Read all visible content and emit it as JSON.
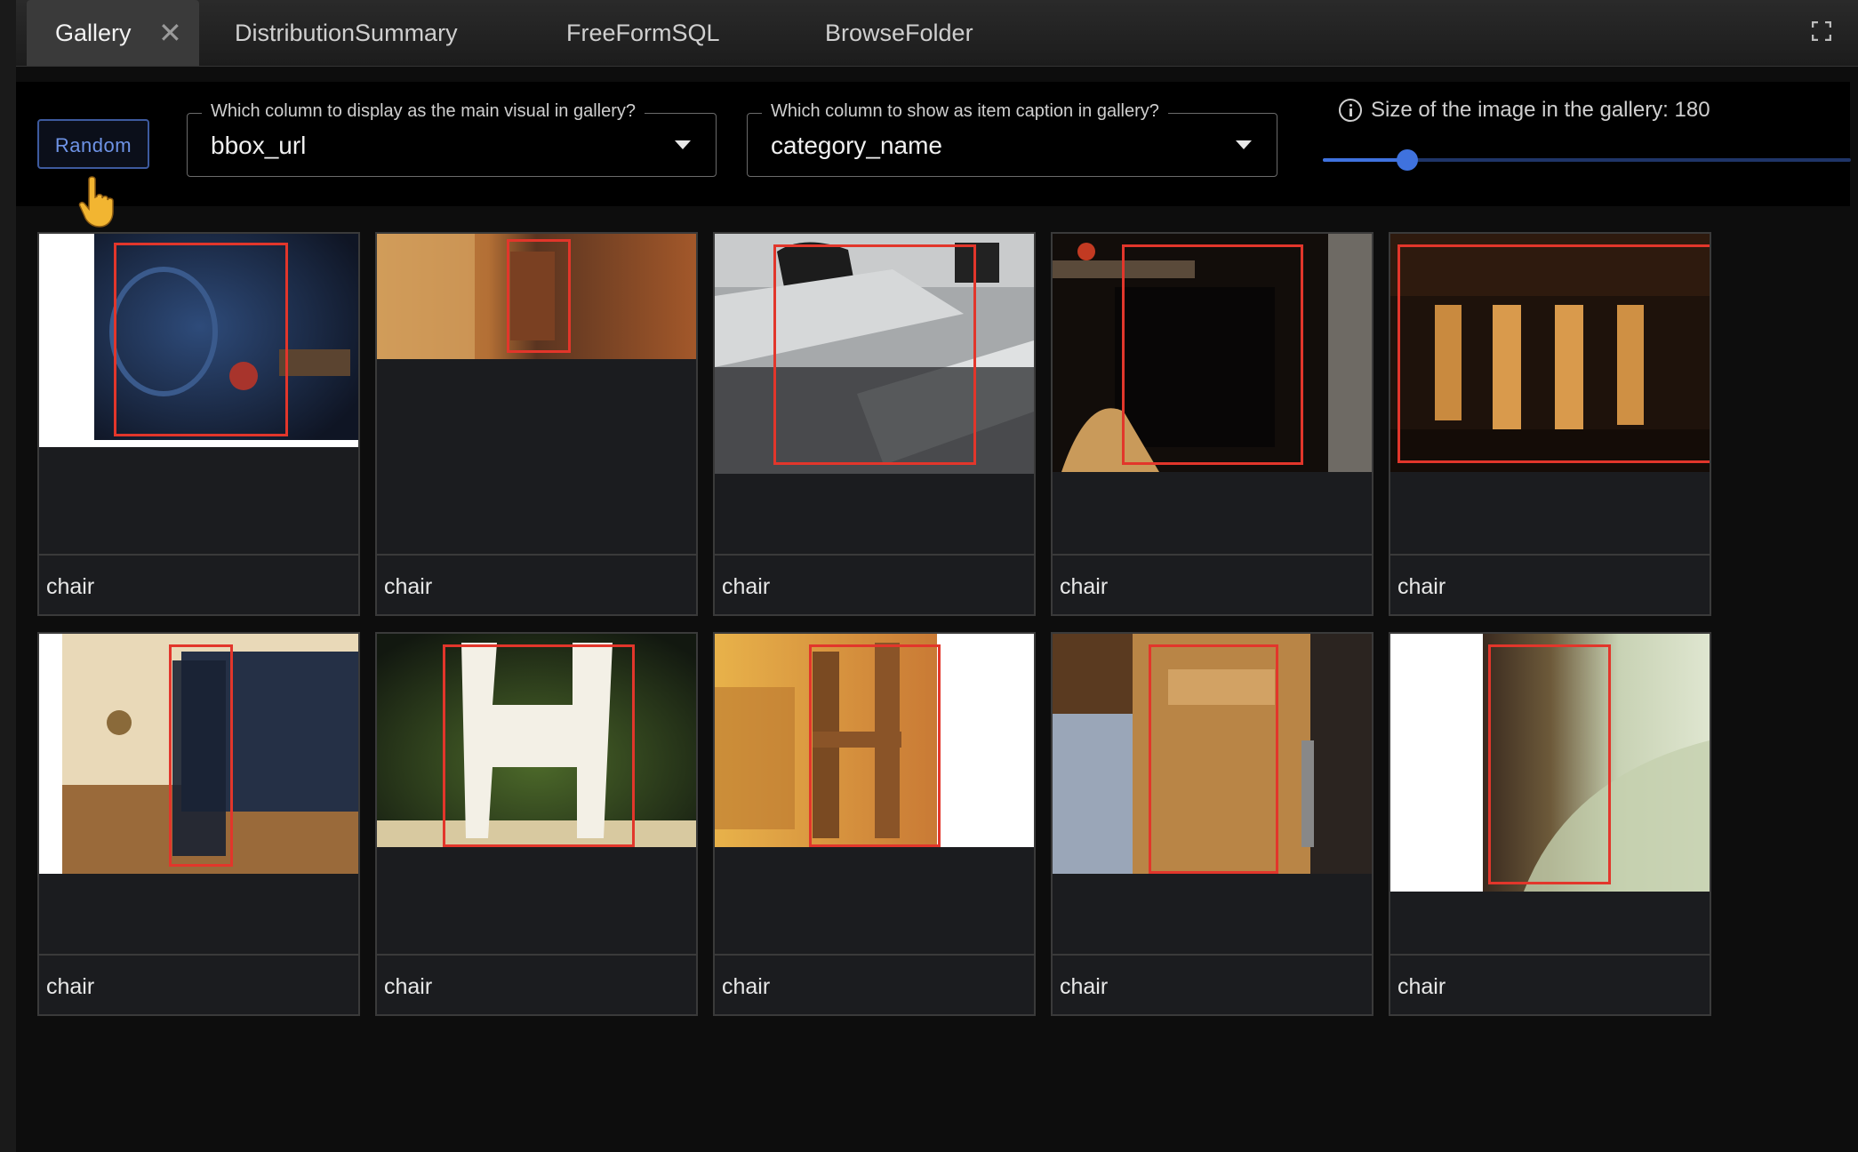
{
  "tabs": [
    {
      "label": "Gallery",
      "active": true
    },
    {
      "label": "DistributionSummary",
      "active": false
    },
    {
      "label": "FreeFormSQL",
      "active": false
    },
    {
      "label": "BrowseFolder",
      "active": false
    }
  ],
  "tab_close_glyph": "✕",
  "controls": {
    "random_label": "Random",
    "main_visual": {
      "label": "Which column to display as the main visual in gallery?",
      "value": "bbox_url"
    },
    "caption_col": {
      "label": "Which column to show as item caption in gallery?",
      "value": "category_name"
    },
    "size": {
      "label": "Size of the image in the gallery: 180",
      "value": 180,
      "fraction": 0.16
    }
  },
  "accent_color": "#3f72de",
  "bbox_color": "#e2362b",
  "gallery": [
    {
      "caption": "chair"
    },
    {
      "caption": "chair"
    },
    {
      "caption": "chair"
    },
    {
      "caption": "chair"
    },
    {
      "caption": "chair"
    },
    {
      "caption": "chair"
    },
    {
      "caption": "chair"
    },
    {
      "caption": "chair"
    },
    {
      "caption": "chair"
    },
    {
      "caption": "chair"
    }
  ]
}
